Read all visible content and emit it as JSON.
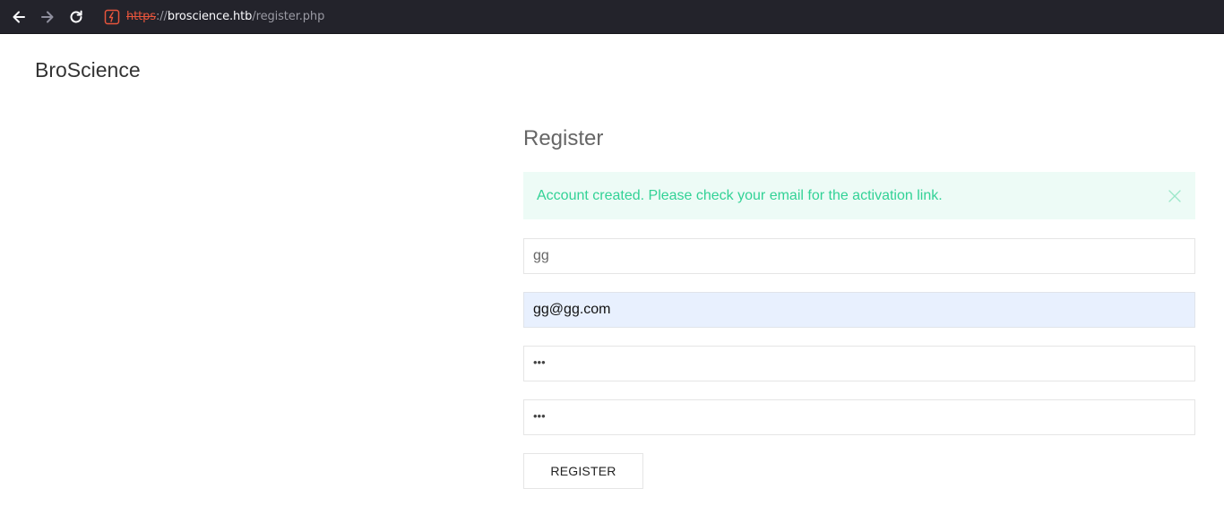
{
  "browser": {
    "url_scheme": "https",
    "url_separator": "://",
    "url_host": "broscience.htb",
    "url_path": "/register.php",
    "icons": [
      "back-arrow-icon",
      "forward-arrow-icon",
      "reload-icon",
      "insecure-connection-icon"
    ]
  },
  "site": {
    "brand": "BroScience"
  },
  "register": {
    "title": "Register",
    "alert": {
      "message": "Account created. Please check your email for the activation link.",
      "color": "#32d296",
      "background": "#edfbf6"
    },
    "fields": {
      "username": "gg",
      "email": "gg@gg.com",
      "password": "•••",
      "password_repeat": "•••"
    },
    "submit_label": "REGISTER"
  },
  "colors": {
    "browser_bar": "#23232b",
    "insecure_accent": "#e8553c",
    "autofill_bg": "#e8f0fe"
  }
}
